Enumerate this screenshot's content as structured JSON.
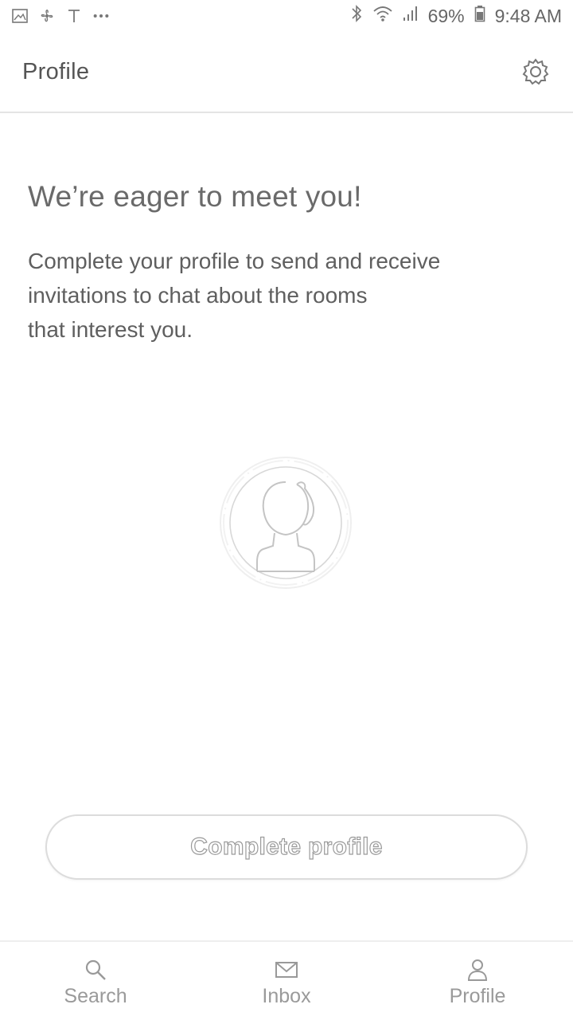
{
  "status_bar": {
    "battery": "69%",
    "time": "9:48 AM",
    "left_icons": [
      "gallery-icon",
      "fan-icon",
      "t-icon",
      "more-dots-icon"
    ],
    "right_icons": [
      "bluetooth-icon",
      "wifi-icon",
      "signal-icon",
      "battery-icon"
    ]
  },
  "app_bar": {
    "title": "Profile",
    "settings_icon": "gear-icon"
  },
  "main": {
    "headline": "We’re eager to meet you!",
    "body_lines": [
      "Complete your profile to send and receive",
      "invitations to chat about the rooms",
      "that interest you."
    ],
    "avatar_icon": "person-placeholder-icon",
    "cta_label": "Complete profile"
  },
  "bottom_nav": {
    "items": [
      {
        "label": "Search",
        "icon": "search-icon"
      },
      {
        "label": "Inbox",
        "icon": "envelope-icon"
      },
      {
        "label": "Profile",
        "icon": "person-icon"
      }
    ]
  },
  "colors": {
    "text": "#555555",
    "muted": "#9a9a9a",
    "divider": "#e4e4e4",
    "background": "#ffffff"
  }
}
